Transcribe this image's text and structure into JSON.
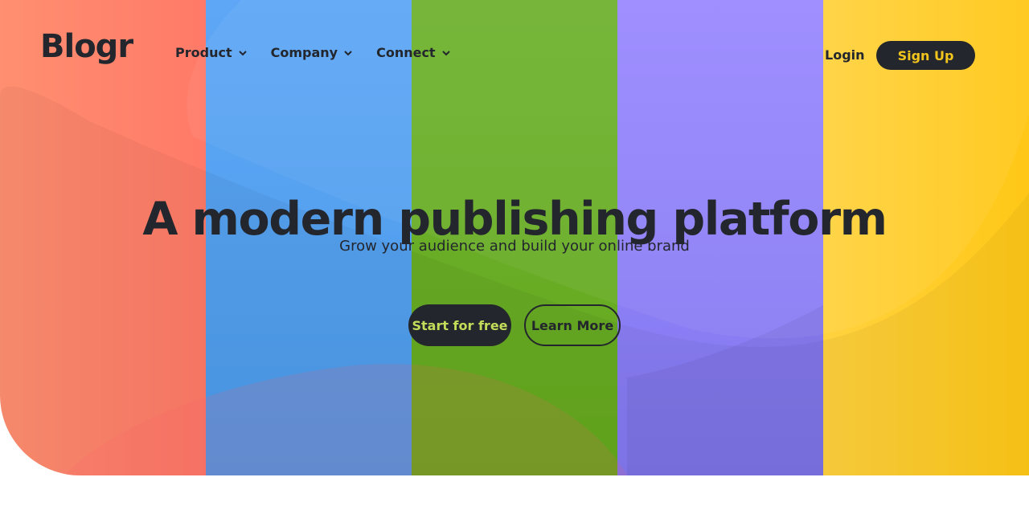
{
  "header": {
    "logo": "Blogr",
    "nav": [
      {
        "label": "Product",
        "icon": "chevron-down-icon"
      },
      {
        "label": "Company",
        "icon": "chevron-down-icon"
      },
      {
        "label": "Connect",
        "icon": "chevron-down-icon"
      }
    ],
    "login": "Login",
    "signup": "Sign Up"
  },
  "hero": {
    "title": "A modern publishing platform",
    "subtitle": "Grow your audience and build your online brand",
    "primary_cta": "Start for free",
    "secondary_cta": "Learn More"
  },
  "colors": {
    "dark": "#23262c",
    "signup_text": "#f2c51d",
    "primary_cta_text": "#c3dc59",
    "stripe_1": "#ff8f70",
    "stripe_2": "#5ea7f6",
    "stripe_3": "#6fb230",
    "stripe_4": "#9a89ff",
    "stripe_5": "#ffd23f"
  }
}
